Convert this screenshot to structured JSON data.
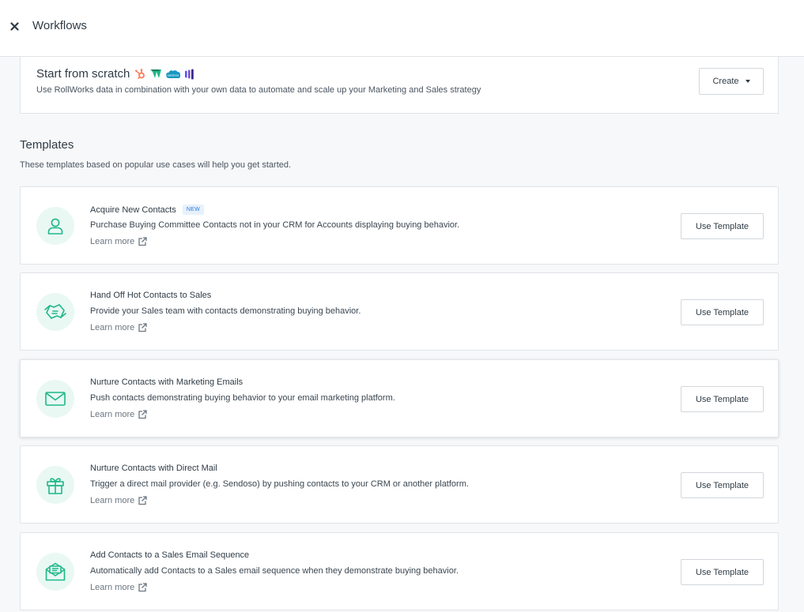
{
  "header": {
    "title": "Workflows"
  },
  "scratch": {
    "title": "Start from scratch",
    "description": "Use RollWorks data in combination with your own data to automate and scale up your Marketing and Sales strategy",
    "create_label": "Create"
  },
  "templates_section": {
    "title": "Templates",
    "description": "These templates based on popular use cases will help you get started."
  },
  "templates": [
    {
      "title": "Acquire New Contacts",
      "badge": "NEW",
      "description": "Purchase Buying Committee Contacts not in your CRM for Accounts displaying buying behavior.",
      "learn_more": "Learn more",
      "button": "Use Template"
    },
    {
      "title": "Hand Off Hot Contacts to Sales",
      "description": "Provide your Sales team with contacts demonstrating buying behavior.",
      "learn_more": "Learn more",
      "button": "Use Template"
    },
    {
      "title": "Nurture Contacts with Marketing Emails",
      "description": "Push contacts demonstrating buying behavior to your email marketing platform.",
      "learn_more": "Learn more",
      "button": "Use Template"
    },
    {
      "title": "Nurture Contacts with Direct Mail",
      "description": "Trigger a direct mail provider (e.g. Sendoso) by pushing contacts to your CRM or another platform.",
      "learn_more": "Learn more",
      "button": "Use Template"
    },
    {
      "title": "Add Contacts to a Sales Email Sequence",
      "description": "Automatically add Contacts to a Sales email sequence when they demonstrate buying behavior.",
      "learn_more": "Learn more",
      "button": "Use Template"
    }
  ],
  "icons": {
    "integrations": [
      "hubspot-icon",
      "marketo-icon",
      "salesforce-icon",
      "outreach-icon"
    ],
    "templates": [
      "person-icon",
      "handshake-icon",
      "envelope-icon",
      "gift-icon",
      "open-envelope-icon"
    ]
  },
  "colors": {
    "accent_green": "#1fb889",
    "icon_bg": "#e9f8f3",
    "hubspot": "#ff7a59",
    "marketo_green": "#1fb889",
    "salesforce": "#1798c1",
    "outreach": "#5951ff",
    "badge_blue": "#2b7bd6"
  }
}
